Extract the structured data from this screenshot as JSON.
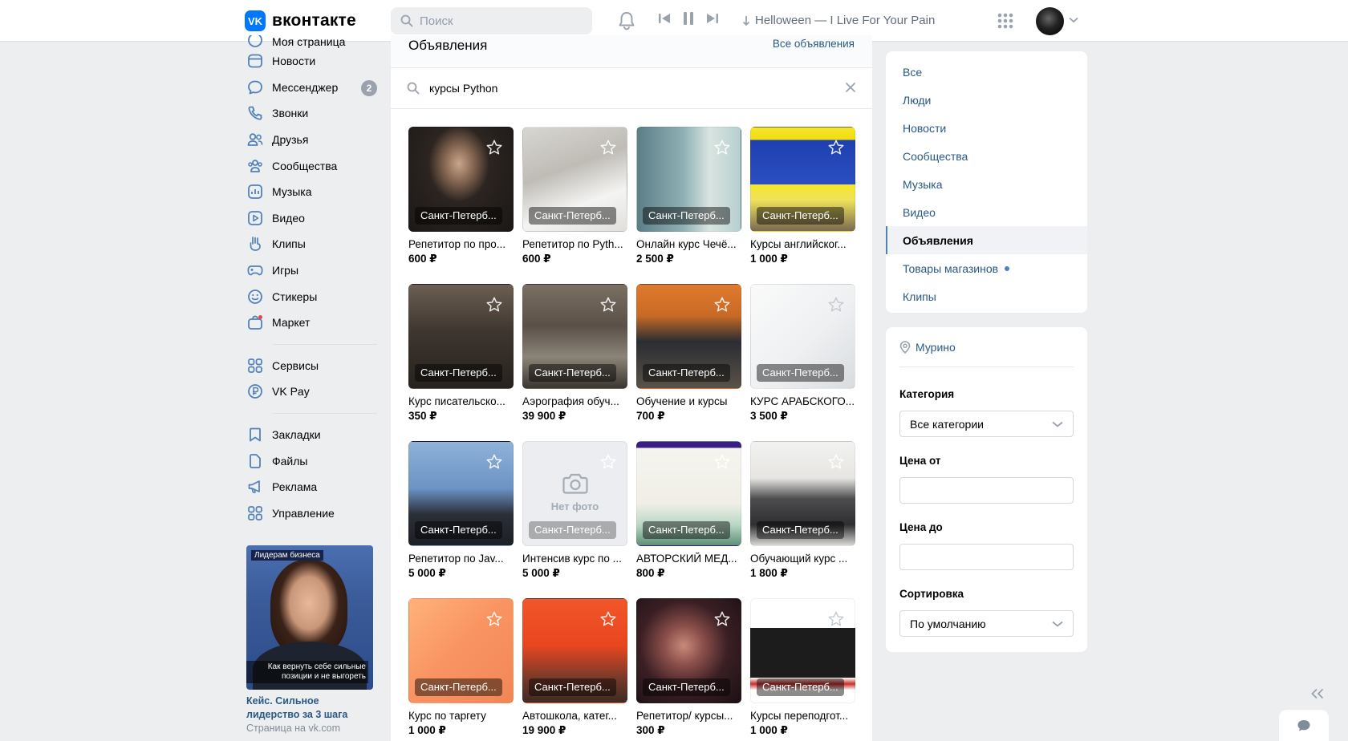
{
  "header": {
    "logo_mark": "VK",
    "logo_text": "вконтакте",
    "search_placeholder": "Поиск",
    "now_playing": "Helloween — I Live For Your Pain"
  },
  "left_nav": {
    "top_cut_label": "Моя страница",
    "items": [
      {
        "label": "Новости",
        "icon": "newspaper-icon"
      },
      {
        "label": "Мессенджер",
        "icon": "chat-icon",
        "badge": "2"
      },
      {
        "label": "Звонки",
        "icon": "phone-icon"
      },
      {
        "label": "Друзья",
        "icon": "friends-icon"
      },
      {
        "label": "Сообщества",
        "icon": "communities-icon"
      },
      {
        "label": "Музыка",
        "icon": "music-icon"
      },
      {
        "label": "Видео",
        "icon": "video-icon"
      },
      {
        "label": "Клипы",
        "icon": "clips-icon"
      },
      {
        "label": "Игры",
        "icon": "gamepad-icon"
      },
      {
        "label": "Стикеры",
        "icon": "smile-icon"
      },
      {
        "label": "Маркет",
        "icon": "market-icon"
      }
    ],
    "group2": [
      {
        "label": "Сервисы",
        "icon": "services-icon"
      },
      {
        "label": "VK Pay",
        "icon": "vkpay-icon"
      }
    ],
    "group3": [
      {
        "label": "Закладки",
        "icon": "bookmark-icon"
      },
      {
        "label": "Файлы",
        "icon": "file-icon"
      },
      {
        "label": "Реклама",
        "icon": "megaphone-icon"
      },
      {
        "label": "Управление",
        "icon": "manage-icon"
      }
    ],
    "ad": {
      "tag": "Лидерам бизнеса",
      "quote": "Как вернуть себе сильные позиции и не выгореть",
      "title": "Кейс. Сильное лидерство за 3 шага",
      "source": "Страница на vk.com"
    }
  },
  "main": {
    "title": "Объявления",
    "all_link": "Все объявления",
    "query": "курсы Python",
    "no_photo": "Нет фото",
    "items": [
      {
        "title": "Репетитор по про...",
        "price": "600 ₽",
        "city": "Санкт-Петерб..."
      },
      {
        "title": "Репетитор по Pyth...",
        "price": "600 ₽",
        "city": "Санкт-Петерб..."
      },
      {
        "title": "Онлайн курс Чечё...",
        "price": "2 500 ₽",
        "city": "Санкт-Петерб..."
      },
      {
        "title": "Курсы английског...",
        "price": "1 000 ₽",
        "city": "Санкт-Петерб..."
      },
      {
        "title": "Курс писательско...",
        "price": "350 ₽",
        "city": "Санкт-Петерб..."
      },
      {
        "title": "Аэрография обуч...",
        "price": "39 900 ₽",
        "city": "Санкт-Петерб..."
      },
      {
        "title": "Обучение и курсы",
        "price": "700 ₽",
        "city": "Санкт-Петерб..."
      },
      {
        "title": "КУРС АРАБСКОГО...",
        "price": "3 500 ₽",
        "city": "Санкт-Петерб..."
      },
      {
        "title": "Репетитор по Jav...",
        "price": "5 000 ₽",
        "city": "Санкт-Петерб..."
      },
      {
        "title": "Интенсив курс по ...",
        "price": "5 000 ₽",
        "city": "Санкт-Петерб..."
      },
      {
        "title": "АВТОРСКИЙ МЕД...",
        "price": "800 ₽",
        "city": "Санкт-Петерб..."
      },
      {
        "title": "Обучающий курс ...",
        "price": "1 800 ₽",
        "city": "Санкт-Петерб..."
      },
      {
        "title": "Курс по таргету",
        "price": "1 000 ₽",
        "city": "Санкт-Петерб..."
      },
      {
        "title": "Автошкола, катег...",
        "price": "19 900 ₽",
        "city": "Санкт-Петерб..."
      },
      {
        "title": "Репетитор/ курсы...",
        "price": "300 ₽",
        "city": "Санкт-Петерб..."
      },
      {
        "title": "Курсы переподгот...",
        "price": "1 000 ₽",
        "city": "Санкт-Петерб..."
      }
    ]
  },
  "right_menu": {
    "items": [
      "Все",
      "Люди",
      "Новости",
      "Сообщества",
      "Музыка",
      "Видео",
      "Объявления",
      "Товары магазинов",
      "Клипы"
    ],
    "active": "Объявления"
  },
  "filters": {
    "location": "Мурино",
    "category_label": "Категория",
    "category_value": "Все категории",
    "price_from_label": "Цена от",
    "price_to_label": "Цена до",
    "sort_label": "Сортировка",
    "sort_value": "По умолчанию"
  }
}
